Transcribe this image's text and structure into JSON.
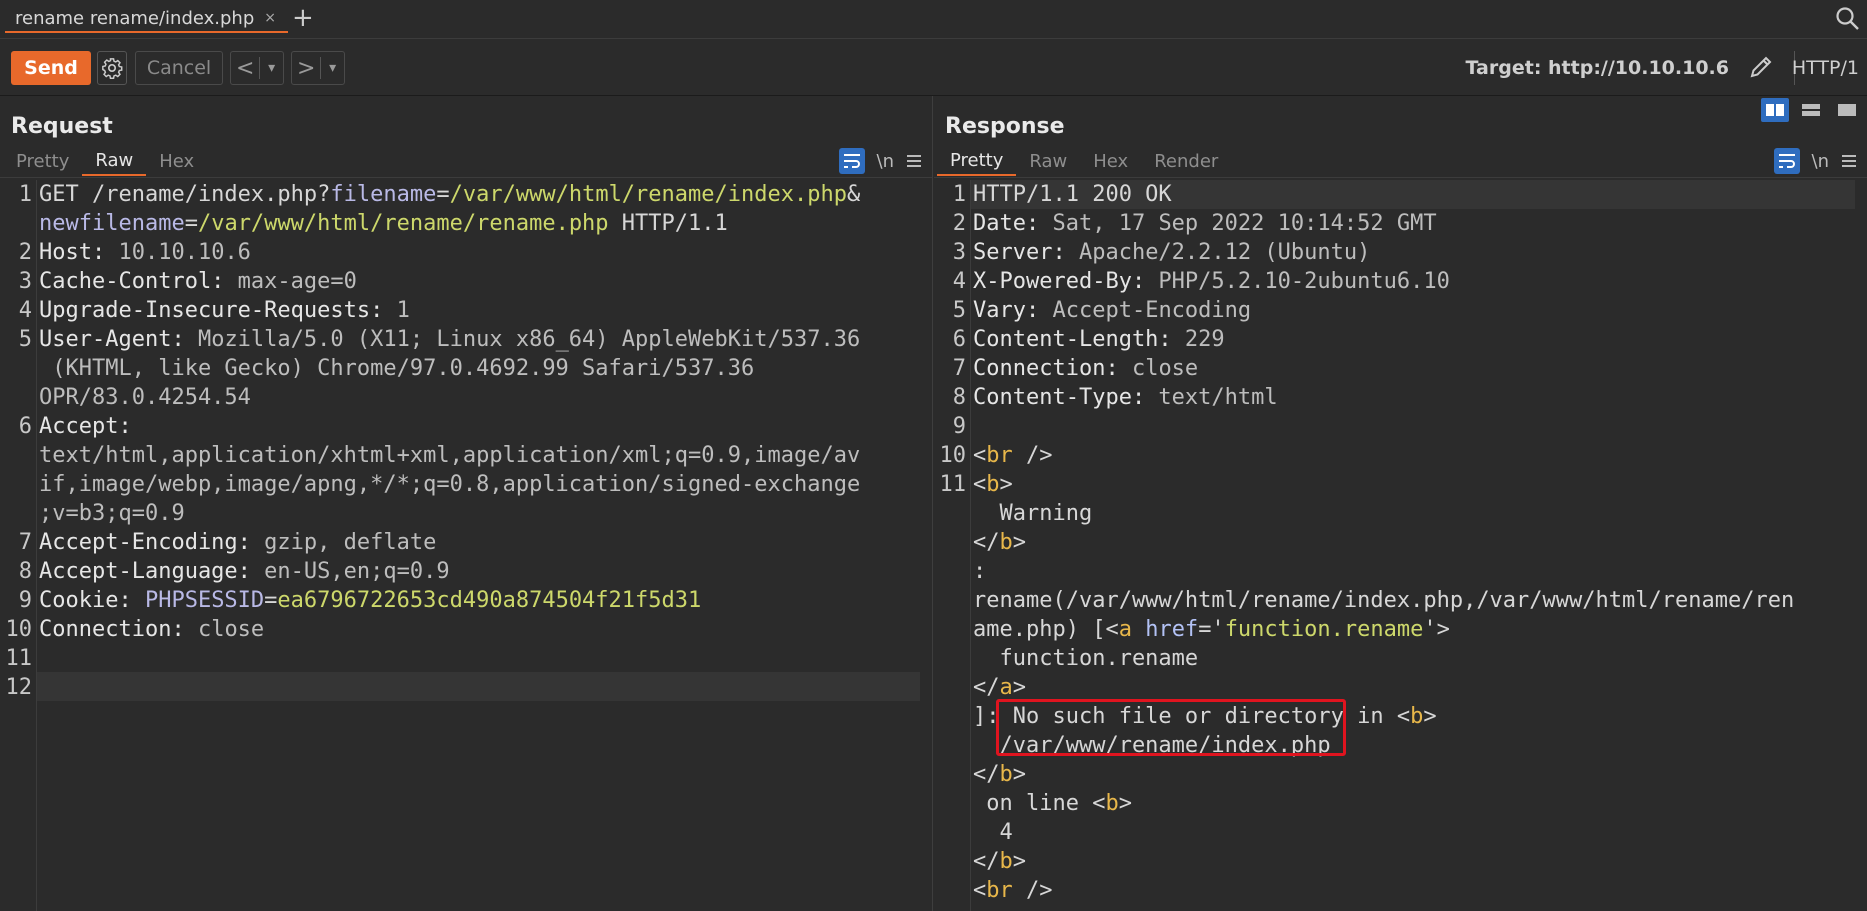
{
  "tab": {
    "label": "rename rename/index.php",
    "close": "×",
    "new": "+"
  },
  "toolbar": {
    "send": "Send",
    "cancel": "Cancel",
    "back": "<",
    "forward": ">",
    "dropdown": "▾",
    "target": "Target: http://10.10.10.6",
    "http_version": "HTTP/1"
  },
  "request": {
    "title": "Request",
    "tabs": [
      "Pretty",
      "Raw",
      "Hex"
    ],
    "newline_toggle": "\\n",
    "line_numbers": [
      "1",
      "2",
      "3",
      "4",
      "5",
      "6",
      "7",
      "8",
      "9",
      "10",
      "11",
      "12"
    ]
  },
  "response": {
    "title": "Response",
    "tabs": [
      "Pretty",
      "Raw",
      "Hex",
      "Render"
    ],
    "newline_toggle": "\\n",
    "line_numbers": [
      "1",
      "2",
      "3",
      "4",
      "5",
      "6",
      "7",
      "8",
      "9",
      "10",
      "11"
    ]
  },
  "colors": {
    "accent": "#e8692b",
    "selected": "#2f6dbf",
    "highlight_box": "#e0141f"
  }
}
